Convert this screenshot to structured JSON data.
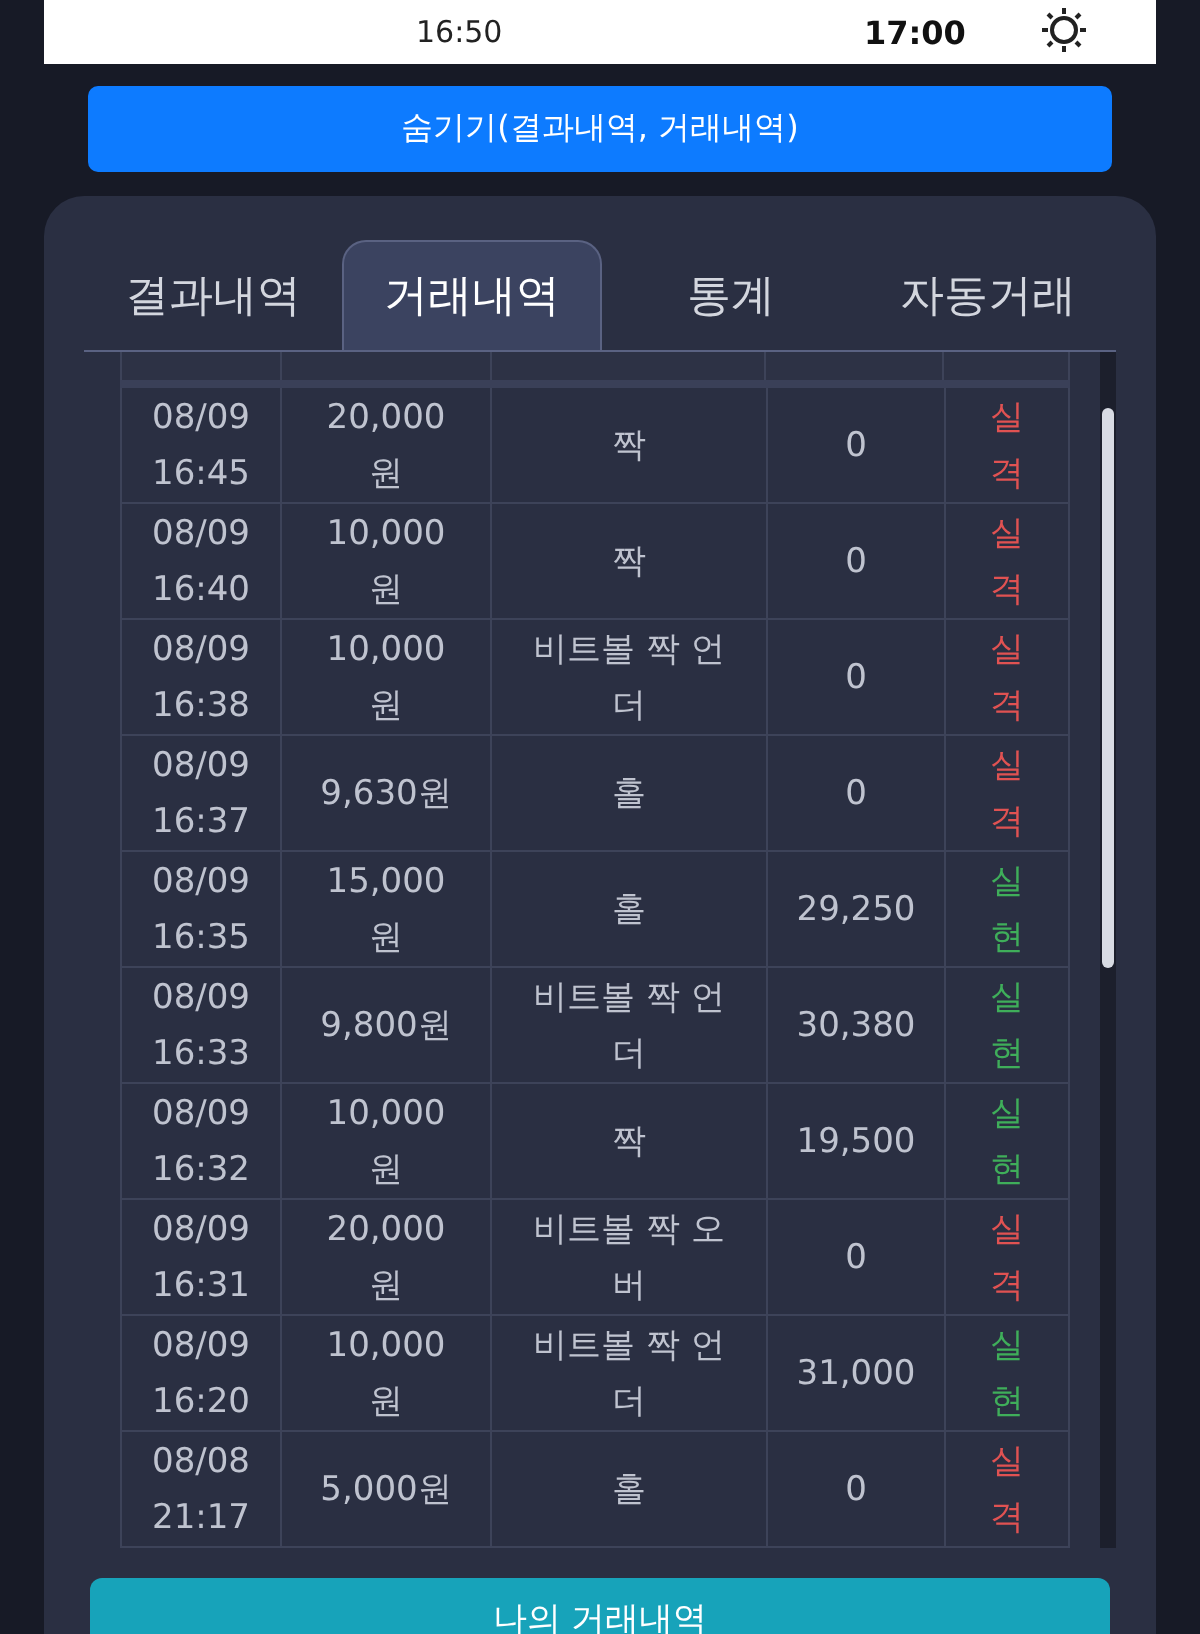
{
  "top_bar": {
    "time_left": "16:50",
    "time_right": "17:00"
  },
  "hide_button": "숨기기(결과내역, 거래내역)",
  "tabs": [
    {
      "label": "결과내역",
      "selected": false
    },
    {
      "label": "거래내역",
      "selected": true
    },
    {
      "label": "통계",
      "selected": false
    },
    {
      "label": "자동거래",
      "selected": false
    }
  ],
  "table": {
    "rows": [
      {
        "time": "08/09 16:45",
        "amount": "20,000원",
        "pick": "짝",
        "payout": "0",
        "result": "실격",
        "won": false
      },
      {
        "time": "08/09 16:40",
        "amount": "10,000원",
        "pick": "짝",
        "payout": "0",
        "result": "실격",
        "won": false
      },
      {
        "time": "08/09 16:38",
        "amount": "10,000원",
        "pick": "비트볼 짝 언더",
        "payout": "0",
        "result": "실격",
        "won": false
      },
      {
        "time": "08/09 16:37",
        "amount": "9,630원",
        "pick": "홀",
        "payout": "0",
        "result": "실격",
        "won": false
      },
      {
        "time": "08/09 16:35",
        "amount": "15,000원",
        "pick": "홀",
        "payout": "29,250",
        "result": "실현",
        "won": true
      },
      {
        "time": "08/09 16:33",
        "amount": "9,800원",
        "pick": "비트볼 짝 언더",
        "payout": "30,380",
        "result": "실현",
        "won": true
      },
      {
        "time": "08/09 16:32",
        "amount": "10,000원",
        "pick": "짝",
        "payout": "19,500",
        "result": "실현",
        "won": true
      },
      {
        "time": "08/09 16:31",
        "amount": "20,000원",
        "pick": "비트볼 짝 오버",
        "payout": "0",
        "result": "실격",
        "won": false
      },
      {
        "time": "08/09 16:20",
        "amount": "10,000원",
        "pick": "비트볼 짝 언더",
        "payout": "31,000",
        "result": "실현",
        "won": true
      },
      {
        "time": "08/08 21:17",
        "amount": "5,000원",
        "pick": "홀",
        "payout": "0",
        "result": "실격",
        "won": false
      }
    ]
  },
  "my_history_button": "나의 거래내역"
}
